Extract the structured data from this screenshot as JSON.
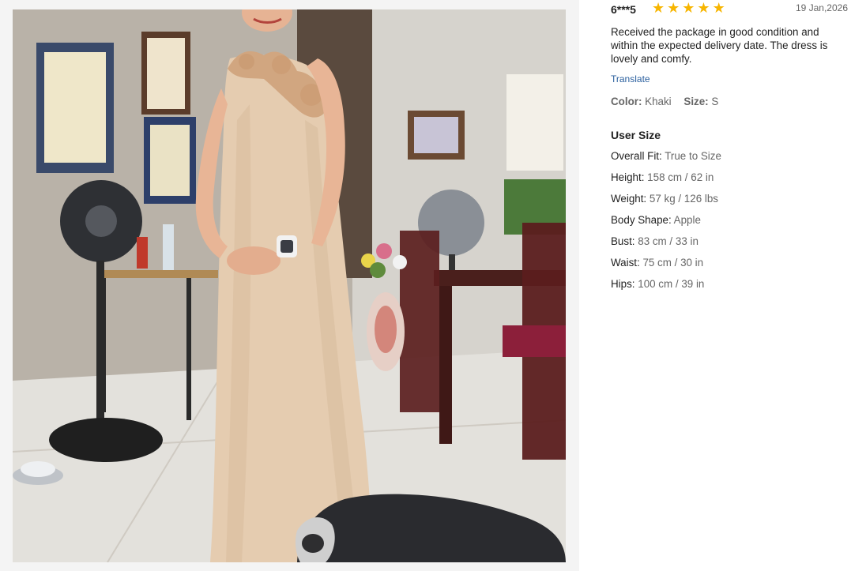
{
  "review": {
    "username": "6***5",
    "rating": 5,
    "date": "19 Jan,2026",
    "text": "Received the package in good condition and within the expected delivery date. The dress is lovely and comfy.",
    "translate_label": "Translate",
    "color_label": "Color:",
    "color_value": "Khaki",
    "size_label": "Size:",
    "size_value": "S"
  },
  "user_size": {
    "title": "User Size",
    "rows": [
      {
        "label": "Overall Fit:",
        "value": "True to Size"
      },
      {
        "label": "Height:",
        "value": "158 cm / 62 in"
      },
      {
        "label": "Weight:",
        "value": "57 kg / 126 lbs"
      },
      {
        "label": "Body Shape:",
        "value": "Apple"
      },
      {
        "label": "Bust:",
        "value": "83 cm / 33 in"
      },
      {
        "label": "Waist:",
        "value": "75 cm / 30 in"
      },
      {
        "label": "Hips:",
        "value": "100 cm / 39 in"
      }
    ]
  },
  "colors": {
    "star": "#f7b500",
    "link": "#2a5f9e",
    "muted": "#666666"
  },
  "icons": {
    "star": "star-icon"
  }
}
